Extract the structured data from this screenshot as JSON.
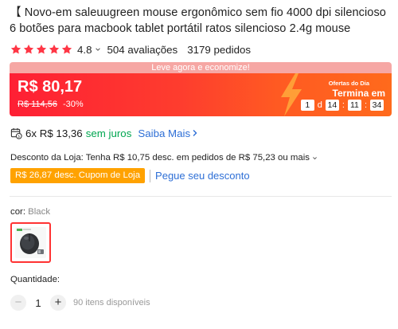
{
  "product": {
    "title": "【 Novo-em saleuugreen mouse ergonômico sem fio 4000 dpi silencioso 6 botões para macbook tablet portátil ratos silencioso 2.4g mouse"
  },
  "rating": {
    "stars_filled": 5,
    "value": "4.8",
    "reviews": "504 avaliações",
    "orders": "3179 pedidos",
    "star_color": "#ff3645"
  },
  "deal": {
    "banner": "Leve agora e economize!",
    "price": "R$ 80,17",
    "old_price": "R$ 114,56",
    "discount": "-30%",
    "offer_label": "Ofertas do Dia",
    "ends_label": "Termina em",
    "timer": {
      "days": "1",
      "day_unit": "d",
      "hours": "14",
      "minutes": "11",
      "seconds": "34"
    },
    "gradient_start": "#fe1f34",
    "gradient_end": "#ff6a1c"
  },
  "installments": {
    "text": "6x R$ 13,36",
    "interest": "sem juros",
    "link": "Saiba Mais"
  },
  "store_discount": {
    "text": "Desconto da Loja: Tenha R$ 10,75 desc. em pedidos de R$ 75,23 ou mais",
    "coupon": "R$ 26,87 desc. Cupom de Loja",
    "coupon_link": "Pegue seu desconto"
  },
  "variant": {
    "label": "cor:",
    "value": "Black"
  },
  "quantity": {
    "label": "Quantidade:",
    "minus": "−",
    "value": "1",
    "plus": "+",
    "stock": "90 itens disponíveis"
  },
  "icons": {
    "star": "star-icon",
    "chevron": "chevron-down-icon",
    "calendar": "calendar-money-icon",
    "arrow": "chevron-right-icon",
    "bolt": "lightning-bolt-icon"
  }
}
